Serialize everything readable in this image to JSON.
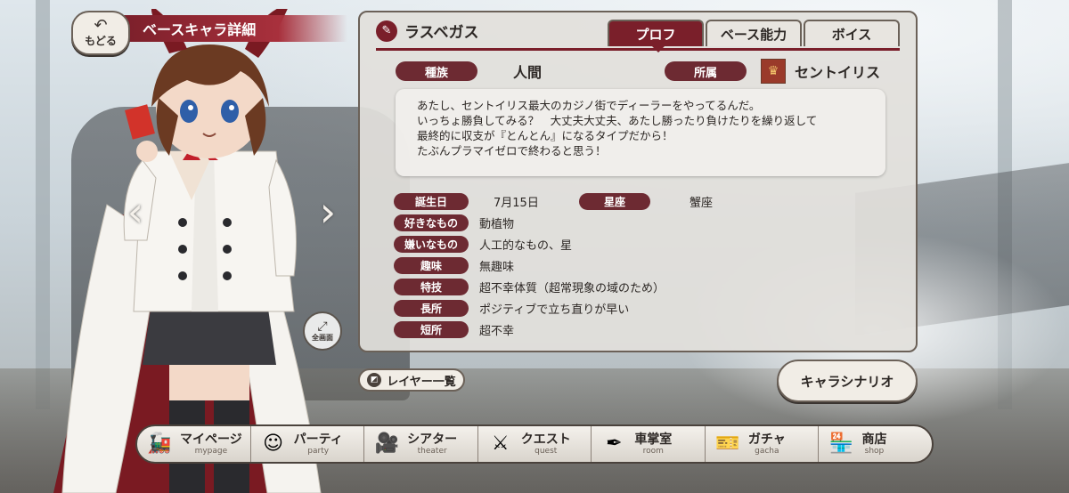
{
  "header": {
    "back_label": "もどる",
    "title": "ベースキャラ詳細"
  },
  "character": {
    "name": "ラスベガス",
    "fullscreen_label": "全画面",
    "fields": {
      "race_label": "種族",
      "race": "人間",
      "affiliation_label": "所属",
      "affiliation": "セントイリス"
    },
    "description": [
      "あたし、セントイリス最大のカジノ街でディーラーをやってるんだ。",
      "いっちょ勝負してみる？　大丈夫大丈夫、あたし勝ったり負けたりを繰り返して",
      "最終的に収支が『とんとん』になるタイプだから！",
      "たぶんプラマイゼロで終わると思う！"
    ],
    "birthday_label": "誕生日",
    "birthday": "7月15日",
    "sign_label": "星座",
    "sign": "蟹座",
    "likes_label": "好きなもの",
    "likes": "動植物",
    "dislikes_label": "嫌いなもの",
    "dislikes": "人工的なもの、星",
    "hobby_label": "趣味",
    "hobby": "無趣味",
    "skill_label": "特技",
    "skill": "超不幸体質（超常現象の域のため）",
    "strength_label": "長所",
    "strength": "ポジティブで立ち直りが早い",
    "weakness_label": "短所",
    "weakness": "超不幸"
  },
  "tabs": [
    {
      "label": "プロフ",
      "active": true
    },
    {
      "label": "ベース能力"
    },
    {
      "label": "ボイス"
    }
  ],
  "buttons": {
    "layer_list": "レイヤー一覧",
    "char_scenario": "キャラシナリオ"
  },
  "bottom_nav": [
    {
      "jp": "マイページ",
      "en": "mypage",
      "icon": "train-icon"
    },
    {
      "jp": "パーティ",
      "en": "party",
      "icon": "party-icon"
    },
    {
      "jp": "シアター",
      "en": "theater",
      "icon": "camera-icon"
    },
    {
      "jp": "クエスト",
      "en": "quest",
      "icon": "swords-icon"
    },
    {
      "jp": "車掌室",
      "en": "room",
      "icon": "quill-icon"
    },
    {
      "jp": "ガチャ",
      "en": "gacha",
      "icon": "ticket-icon"
    },
    {
      "jp": "商店",
      "en": "shop",
      "icon": "shop-icon"
    }
  ],
  "colors": {
    "accent": "#7a1f2a",
    "tag": "#6d2a32"
  }
}
